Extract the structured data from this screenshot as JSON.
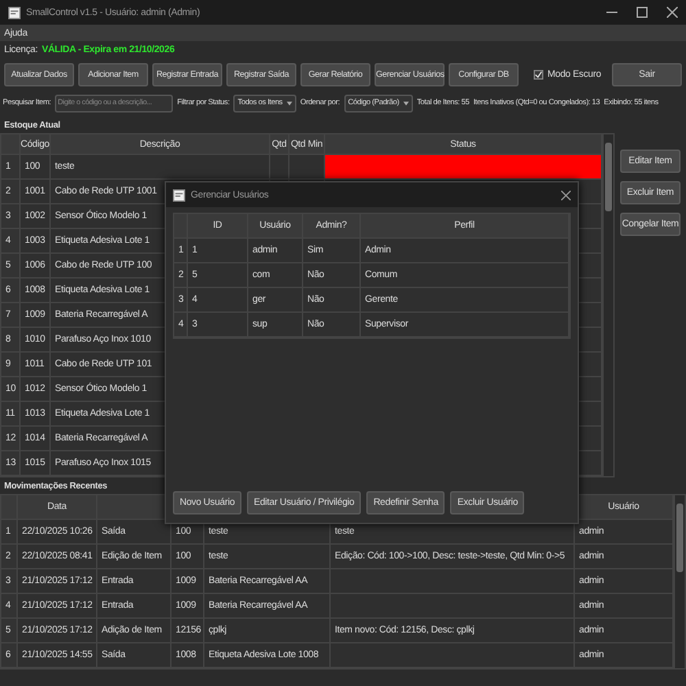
{
  "window": {
    "title": "SmallControl v1.5 - Usuário: admin (Admin)"
  },
  "menu": [
    "Ajuda"
  ],
  "license": {
    "label": "Licença:",
    "status": "VÁLIDA - Expira em 21/10/2026",
    "valid": true
  },
  "toolbar": {
    "buttons": [
      "Atualizar Dados",
      "Adicionar Item",
      "Registrar Entrada",
      "Registrar Saída",
      "Gerar Relatório",
      "Gerenciar Usuários",
      "Configurar DB"
    ],
    "dark_mode": {
      "label": "Modo Escuro",
      "checked": true
    },
    "exit": "Sair"
  },
  "filters": {
    "search": {
      "label": "Pesquisar Item:",
      "placeholder": "Digite o código ou a descrição..."
    },
    "status": {
      "label": "Filtrar por Status:",
      "value": "Todos os Itens"
    },
    "sort": {
      "label": "Ordenar por:",
      "value": "Código (Padrão)"
    },
    "total": "Total de Itens: 55",
    "inactive": "Itens Inativos (Qtd=0 ou Congelados): 13",
    "showing": "Exibindo: 55 itens"
  },
  "stock": {
    "title": "Estoque Atual",
    "columns": [
      "Código",
      "Descrição",
      "Qtd",
      "Qtd Min",
      "Status"
    ],
    "rows": [
      {
        "n": "1",
        "code": "100",
        "description": "teste",
        "color": "#ff0000"
      },
      {
        "n": "2",
        "code": "1001",
        "description": "Cabo de Rede UTP 1001"
      },
      {
        "n": "3",
        "code": "1002",
        "description": "Sensor Ótico Modelo 1"
      },
      {
        "n": "4",
        "code": "1003",
        "description": "Etiqueta Adesiva Lote 1"
      },
      {
        "n": "5",
        "code": "1006",
        "description": "Cabo de Rede UTP 100"
      },
      {
        "n": "6",
        "code": "1008",
        "description": "Etiqueta Adesiva Lote 1"
      },
      {
        "n": "7",
        "code": "1009",
        "description": "Bateria Recarregável A"
      },
      {
        "n": "8",
        "code": "1010",
        "description": "Parafuso Aço Inox 1010"
      },
      {
        "n": "9",
        "code": "1011",
        "description": "Cabo de Rede UTP 101"
      },
      {
        "n": "10",
        "code": "1012",
        "description": "Sensor Ótico Modelo 1"
      },
      {
        "n": "11",
        "code": "1013",
        "description": "Etiqueta Adesiva Lote 1"
      },
      {
        "n": "12",
        "code": "1014",
        "description": "Bateria Recarregável A"
      },
      {
        "n": "13",
        "code": "1015",
        "description": "Parafuso Aço Inox 1015"
      }
    ]
  },
  "item_actions": [
    "Editar Item",
    "Excluir Item",
    "Congelar Item"
  ],
  "movements": {
    "title": "Movimentações Recentes",
    "columns": [
      {
        "label": "Data"
      },
      {},
      {},
      {},
      {},
      {
        "label": "Usuário"
      }
    ],
    "rows": [
      {
        "n": "1",
        "cells": [
          "22/10/2025 10:26",
          "Saída",
          "100",
          "teste",
          "teste",
          "admin"
        ]
      },
      {
        "n": "2",
        "cells": [
          "22/10/2025 08:41",
          "Edição de Item",
          "100",
          "teste",
          "Edição: Cód: 100->100, Desc: teste->teste, Qtd Min: 0->5",
          "admin"
        ]
      },
      {
        "n": "3",
        "cells": [
          "21/10/2025 17:12",
          "Entrada",
          "1009",
          "Bateria Recarregável AA",
          null,
          "admin"
        ]
      },
      {
        "n": "4",
        "cells": [
          "21/10/2025 17:12",
          "Entrada",
          "1009",
          "Bateria Recarregável AA",
          null,
          "admin"
        ]
      },
      {
        "n": "5",
        "cells": [
          "21/10/2025 17:12",
          "Adição de Item",
          "12156",
          "çplkj",
          "Item novo: Cód: 12156, Desc: çplkj",
          "admin"
        ]
      },
      {
        "n": "6",
        "cells": [
          "21/10/2025 14:55",
          "Saída",
          "1008",
          "Etiqueta Adesiva Lote 1008",
          null,
          "admin"
        ]
      }
    ]
  },
  "dialog": {
    "title": "Gerenciar Usuários",
    "columns": [
      "ID",
      "Usuário",
      "Admin?",
      "Perfil"
    ],
    "rows": [
      {
        "n": "1",
        "cells": [
          "1",
          "admin",
          "Sim",
          "Admin"
        ]
      },
      {
        "n": "2",
        "cells": [
          "5",
          "com",
          "Não",
          "Comum"
        ]
      },
      {
        "n": "3",
        "cells": [
          "4",
          "ger",
          "Não",
          "Gerente"
        ]
      },
      {
        "n": "4",
        "cells": [
          "3",
          "sup",
          "Não",
          "Supervisor"
        ]
      }
    ],
    "buttons": [
      "Novo Usuário",
      "Editar Usuário / Privilégio",
      "Redefinir Senha",
      "Excluir Usuário"
    ]
  }
}
